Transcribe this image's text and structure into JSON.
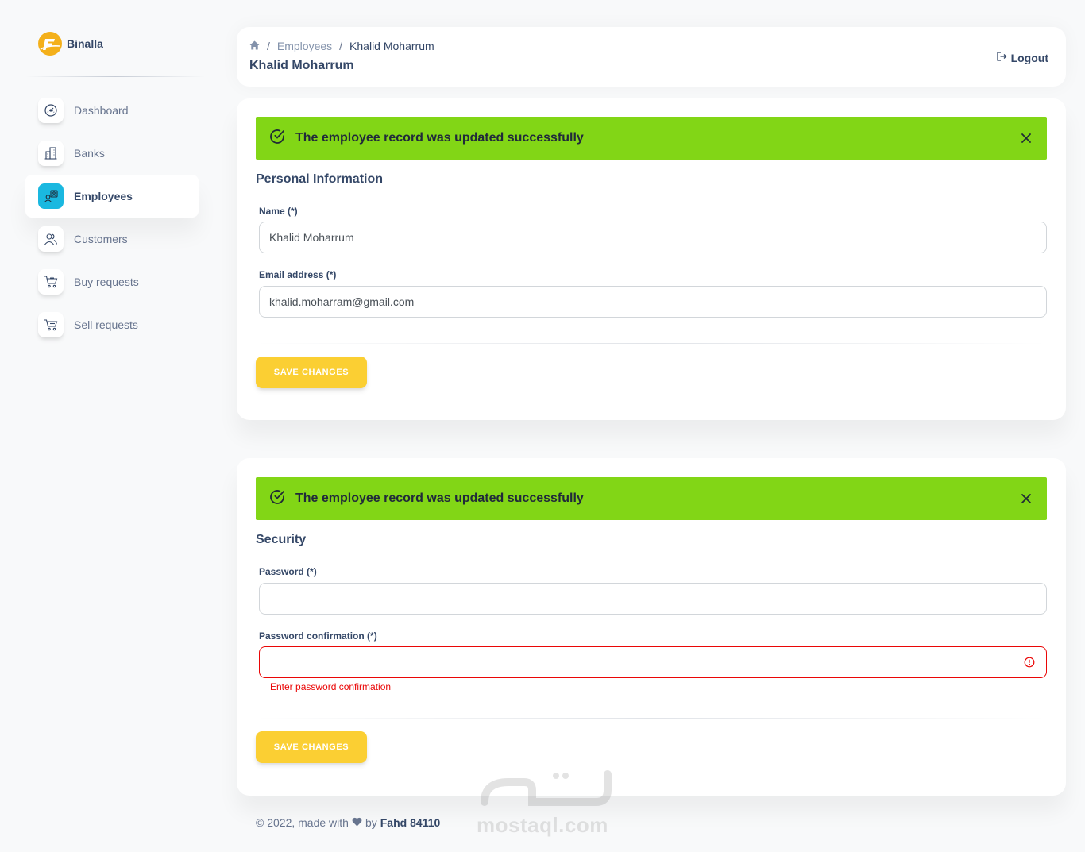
{
  "brand": {
    "name": "Binalla",
    "color": "#f4b01a"
  },
  "sidebar": {
    "items": [
      {
        "label": "Dashboard",
        "icon": "dashboard-gauge-icon",
        "active": false
      },
      {
        "label": "Banks",
        "icon": "building-icon",
        "active": false
      },
      {
        "label": "Employees",
        "icon": "employee-badge-icon",
        "active": true
      },
      {
        "label": "Customers",
        "icon": "users-icon",
        "active": false
      },
      {
        "label": "Buy requests",
        "icon": "cart-plus-icon",
        "active": false
      },
      {
        "label": "Sell requests",
        "icon": "cart-icon",
        "active": false
      }
    ]
  },
  "header": {
    "breadcrumb": {
      "home_icon": "home-icon",
      "parent": "Employees",
      "current": "Khalid Moharrum"
    },
    "title": "Khalid Moharrum",
    "logout_label": "Logout"
  },
  "personal_card": {
    "alert": {
      "text": "The employee record was updated successfully",
      "color": "#82d616"
    },
    "section_title": "Personal Information",
    "name_label": "Name (*)",
    "name_value": "Khalid Moharrum",
    "email_label": "Email address (*)",
    "email_value": "khalid.moharram@gmail.com",
    "save_label": "SAVE CHANGES"
  },
  "security_card": {
    "alert": {
      "text": "The employee record was updated successfully",
      "color": "#82d616"
    },
    "section_title": "Security",
    "password_label": "Password (*)",
    "password_value": "",
    "confirm_label": "Password confirmation (*)",
    "confirm_value": "",
    "confirm_error": "Enter password confirmation",
    "save_label": "SAVE CHANGES"
  },
  "footer": {
    "prefix": "© 2022, made with",
    "by": "by",
    "author": "Fahd 84110"
  },
  "watermark": {
    "text": "mostaql.com"
  },
  "colors": {
    "accent": "#1ab8e0",
    "button": "#fbcf33",
    "error": "#ea0606"
  }
}
